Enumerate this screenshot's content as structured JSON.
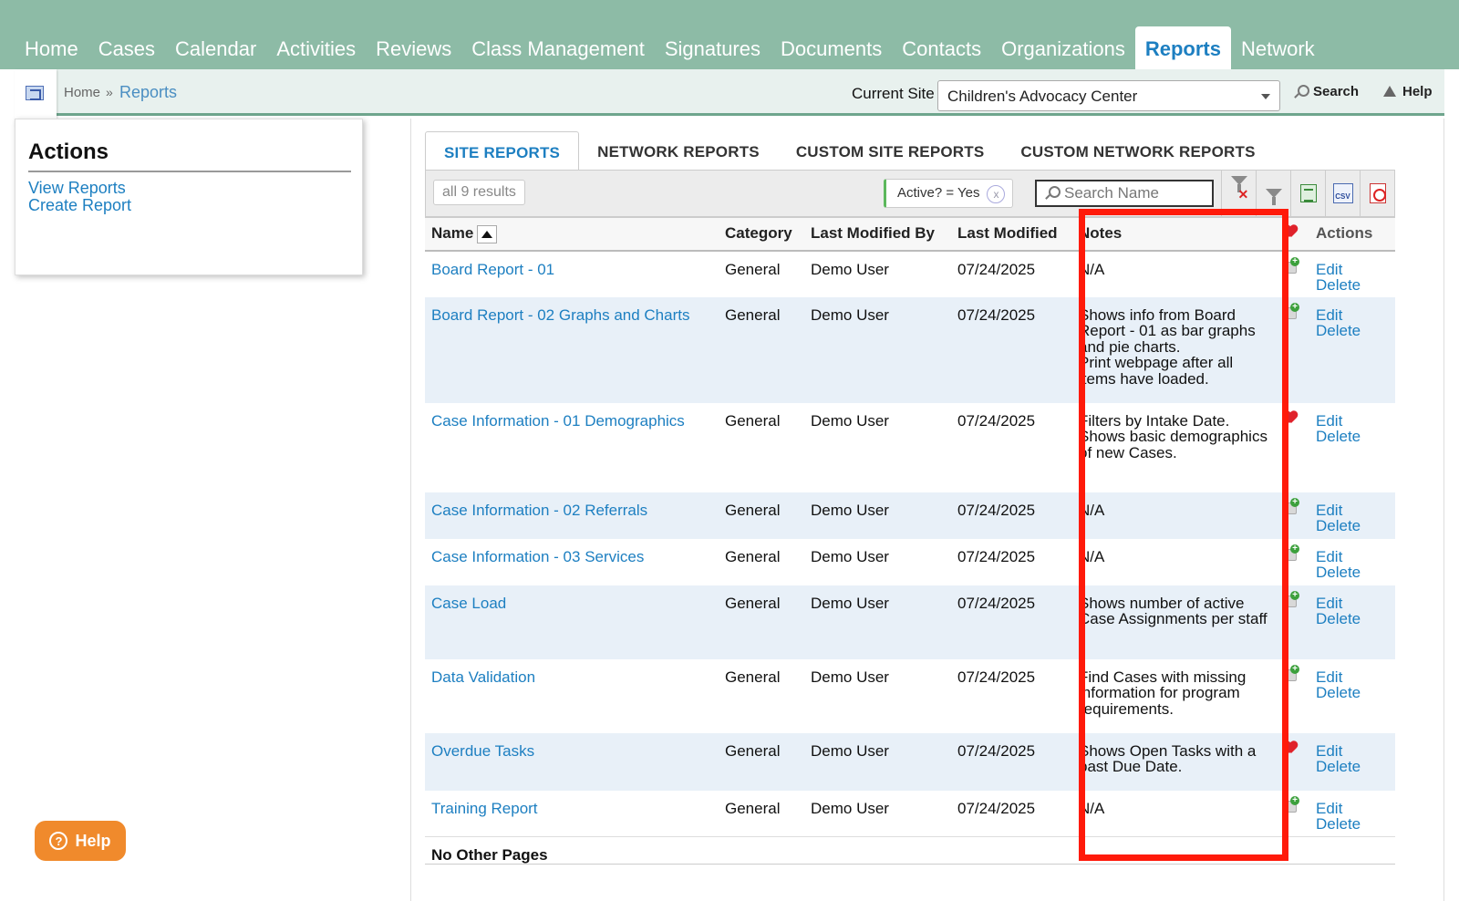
{
  "topnav": {
    "items": [
      "Home",
      "Cases",
      "Calendar",
      "Activities",
      "Reviews",
      "Class Management",
      "Signatures",
      "Documents",
      "Contacts",
      "Organizations",
      "Reports",
      "Network"
    ],
    "active": "Reports"
  },
  "breadcrumb": {
    "home": "Home",
    "separator": "»",
    "current": "Reports"
  },
  "header": {
    "current_site_label": "Current Site",
    "current_site_value": "Children's Advocacy Center",
    "search_label": "Search",
    "help_label": "Help"
  },
  "actions": {
    "title": "Actions",
    "links": [
      "View Reports",
      "Create Report"
    ]
  },
  "help_button": {
    "label": "Help"
  },
  "tabs": [
    "SITE REPORTS",
    "NETWORK REPORTS",
    "CUSTOM SITE REPORTS",
    "CUSTOM NETWORK REPORTS"
  ],
  "toolbar": {
    "results": "all 9 results",
    "filter_chip": "Active? = Yes",
    "filter_clear": "x",
    "search_placeholder": "Search Name",
    "csv_label": "CSV"
  },
  "table": {
    "columns": [
      "Name",
      "Category",
      "Last Modified By",
      "Last Modified",
      "Notes",
      "",
      "Actions"
    ],
    "rows": [
      {
        "name": "Board Report - 01",
        "category": "General",
        "modified_by": "Demo User",
        "modified": "07/24/2025",
        "notes": [
          "N/A"
        ],
        "favorite": false
      },
      {
        "name": "Board Report - 02 Graphs and Charts",
        "category": "General",
        "modified_by": "Demo User",
        "modified": "07/24/2025",
        "notes": [
          "Shows info from Board Report - 01 as bar graphs and pie charts.",
          "Print webpage after all items have loaded."
        ],
        "favorite": false
      },
      {
        "name": "Case Information - 01 Demographics",
        "category": "General",
        "modified_by": "Demo User",
        "modified": "07/24/2025",
        "notes": [
          "Filters by Intake Date.",
          "Shows basic demographics of new Cases."
        ],
        "favorite": true
      },
      {
        "name": "Case Information - 02 Referrals",
        "category": "General",
        "modified_by": "Demo User",
        "modified": "07/24/2025",
        "notes": [
          "N/A"
        ],
        "favorite": false
      },
      {
        "name": "Case Information - 03 Services",
        "category": "General",
        "modified_by": "Demo User",
        "modified": "07/24/2025",
        "notes": [
          "N/A"
        ],
        "favorite": false
      },
      {
        "name": "Case Load",
        "category": "General",
        "modified_by": "Demo User",
        "modified": "07/24/2025",
        "notes": [
          "Shows number of active Case Assignments per staff"
        ],
        "favorite": false
      },
      {
        "name": "Data Validation",
        "category": "General",
        "modified_by": "Demo User",
        "modified": "07/24/2025",
        "notes": [
          "Find Cases with missing information for program requirements."
        ],
        "favorite": false
      },
      {
        "name": "Overdue Tasks",
        "category": "General",
        "modified_by": "Demo User",
        "modified": "07/24/2025",
        "notes": [
          "Shows Open Tasks with a past Due Date."
        ],
        "favorite": true
      },
      {
        "name": "Training Report",
        "category": "General",
        "modified_by": "Demo User",
        "modified": "07/24/2025",
        "notes": [
          "N/A"
        ],
        "favorite": false
      }
    ],
    "edit_label": "Edit",
    "delete_label": "Delete",
    "footer": "No Other Pages"
  },
  "colors": {
    "nav_bg": "#8dbba6",
    "link": "#1d7fc1",
    "highlight": "#ff1a0a",
    "help_orange": "#f08a2c"
  }
}
